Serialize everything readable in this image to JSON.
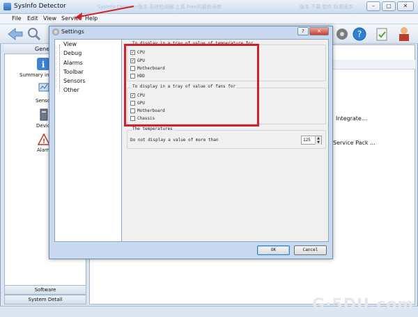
{
  "app": {
    "title": "SysInfo Detector",
    "blurred_title": "SysInfo Detector版本 系统检测器 上真 Free的最新读者",
    "blurred_title_right": "版本 下载 软件 标准版本",
    "window_buttons": [
      "–",
      "▢",
      "✕"
    ]
  },
  "menu": [
    "File",
    "Edit",
    "View",
    "Service",
    "Help"
  ],
  "left_panel": {
    "header": "General",
    "items": [
      "Summary information",
      "Sensors",
      "Devices",
      "Alarms"
    ],
    "bottom_tabs": [
      "Software",
      "System Detail"
    ]
  },
  "right_panel": {
    "texts": [
      "Integrate...",
      "Service Pack ..."
    ]
  },
  "dialog": {
    "title": "Settings",
    "help": "?",
    "close": "✕",
    "tree": [
      "View",
      "Debug",
      "Alarms",
      "Toolbar",
      "Sensors",
      "Other"
    ],
    "temp_group": {
      "label": "To display in a tray of value of temperature for",
      "items": [
        {
          "label": "CPU",
          "checked": true
        },
        {
          "label": "GPU",
          "checked": true
        },
        {
          "label": "Motherboard",
          "checked": false
        },
        {
          "label": "HDD",
          "checked": false
        }
      ]
    },
    "fans_group": {
      "label": "To display in a tray of value of fans for",
      "items": [
        {
          "label": "CPU",
          "checked": true
        },
        {
          "label": "GPU",
          "checked": false
        },
        {
          "label": "Motherboard",
          "checked": false
        },
        {
          "label": "Chassis",
          "checked": false
        }
      ]
    },
    "temps_group": {
      "label": "The temperatures",
      "row_label": "Do not display a value of more than",
      "value": "125"
    },
    "ok": "OK",
    "cancel": "Cancel"
  },
  "watermark": "G·5DU.com",
  "check_mark": "✓",
  "colors": {
    "highlight": "#d0202a",
    "arrow": "#d0202a",
    "dialog_bg": "#c9daf0"
  }
}
